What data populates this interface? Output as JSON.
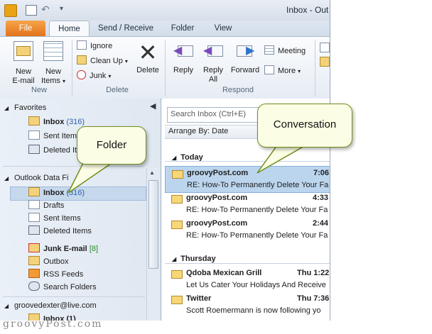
{
  "titlebar": {
    "title": "Inbox - Out"
  },
  "tabs": [
    "File",
    "Home",
    "Send / Receive",
    "Folder",
    "View"
  ],
  "ribbon": {
    "new": {
      "new_email": "New",
      "new_email2": "E-mail",
      "new_items": "New",
      "new_items2": "Items",
      "group": "New"
    },
    "delete": {
      "ignore": "Ignore",
      "cleanup": "Clean Up",
      "junk": "Junk",
      "delete": "Delete",
      "group": "Delete"
    },
    "respond": {
      "reply": "Reply",
      "reply_all": "Reply",
      "reply_all2": "All",
      "forward": "Forward",
      "meeting": "Meeting",
      "more": "More",
      "group": "Respond"
    }
  },
  "nav": {
    "favorites_header": "Favorites",
    "favorites": [
      {
        "label": "Inbox",
        "count": "(316)"
      },
      {
        "label": "Sent Item",
        "count": ""
      },
      {
        "label": "Deleted It",
        "count": ""
      }
    ],
    "datafile_header": "Outlook Data Fi",
    "folders": [
      {
        "label": "Inbox",
        "count": "(316)"
      },
      {
        "label": "Drafts",
        "count": ""
      },
      {
        "label": "Sent Items",
        "count": ""
      },
      {
        "label": "Deleted Items",
        "count": ""
      },
      {
        "label": "Junk E-mail",
        "count": "[8]"
      },
      {
        "label": "Outbox",
        "count": ""
      },
      {
        "label": "RSS Feeds",
        "count": ""
      },
      {
        "label": "Search Folders",
        "count": ""
      }
    ],
    "account": "groovedexter@live.com",
    "account_inbox": "Inbox (1)"
  },
  "mail": {
    "search_placeholder": "Search Inbox (Ctrl+E)",
    "arrange": "Arrange By: Date",
    "group_today": "Today",
    "group_thursday": "Thursday",
    "messages": [
      {
        "sender": "groovyPost.com",
        "time": "7:06",
        "subject": "RE: How-To Permanently Delete Your Fa"
      },
      {
        "sender": "groovyPost.com",
        "time": "4:33",
        "subject": "RE: How-To Permanently Delete Your Fa"
      },
      {
        "sender": "groovyPost.com",
        "time": "2:44",
        "subject": "RE: How-To Permanently Delete Your Fa"
      },
      {
        "sender": "Qdoba Mexican Grill",
        "time": "Thu 1:22",
        "subject": "Let Us Cater Your Holidays And Receive"
      },
      {
        "sender": "Twitter",
        "time": "Thu 7:36",
        "subject": "Scott Roemermann is now following yo"
      }
    ]
  },
  "callouts": {
    "folder": "Folder",
    "conversation": "Conversation"
  },
  "watermark": "groovyPost.com",
  "colors": {
    "file_tab": "#e2731c",
    "selected_row": "#bcd5ee",
    "count_blue": "#2a5fb0",
    "callout_border": "#6d8e1c"
  }
}
